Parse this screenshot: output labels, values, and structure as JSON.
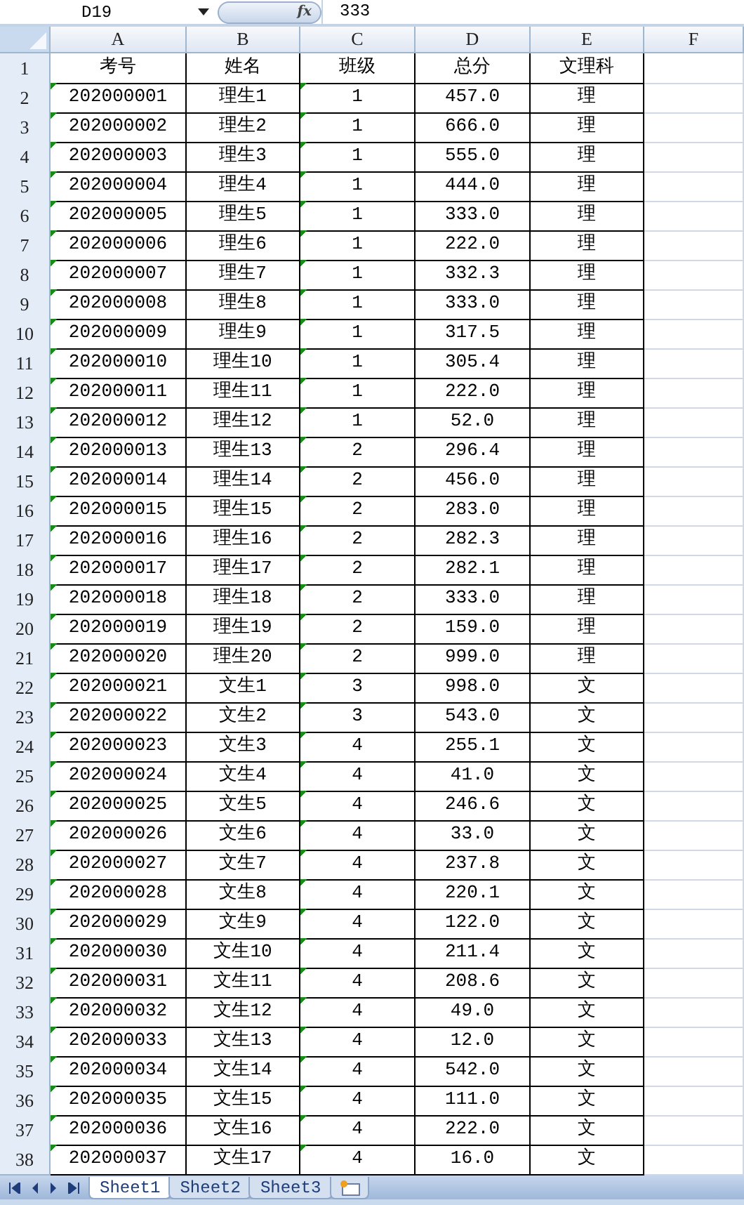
{
  "formula_bar": {
    "name_box": "D19",
    "fx": "fx",
    "value": "333"
  },
  "columns": [
    {
      "letter": "A",
      "flagged": true
    },
    {
      "letter": "B",
      "flagged": false
    },
    {
      "letter": "C",
      "flagged": true
    },
    {
      "letter": "D",
      "flagged": false
    },
    {
      "letter": "E",
      "flagged": false
    }
  ],
  "empty_column": "F",
  "rows": [
    {
      "n": "1",
      "kind": "header",
      "cells": [
        "考号",
        "姓名",
        "班级",
        "总分",
        "文理科"
      ]
    },
    {
      "n": "2",
      "kind": "data",
      "cells": [
        "202000001",
        "理生1",
        "1",
        "457.0",
        "理"
      ]
    },
    {
      "n": "3",
      "kind": "data",
      "cells": [
        "202000002",
        "理生2",
        "1",
        "666.0",
        "理"
      ]
    },
    {
      "n": "4",
      "kind": "data",
      "cells": [
        "202000003",
        "理生3",
        "1",
        "555.0",
        "理"
      ]
    },
    {
      "n": "5",
      "kind": "data",
      "cells": [
        "202000004",
        "理生4",
        "1",
        "444.0",
        "理"
      ]
    },
    {
      "n": "6",
      "kind": "data",
      "cells": [
        "202000005",
        "理生5",
        "1",
        "333.0",
        "理"
      ]
    },
    {
      "n": "7",
      "kind": "data",
      "cells": [
        "202000006",
        "理生6",
        "1",
        "222.0",
        "理"
      ]
    },
    {
      "n": "8",
      "kind": "data",
      "cells": [
        "202000007",
        "理生7",
        "1",
        "332.3",
        "理"
      ]
    },
    {
      "n": "9",
      "kind": "data",
      "cells": [
        "202000008",
        "理生8",
        "1",
        "333.0",
        "理"
      ]
    },
    {
      "n": "10",
      "kind": "data",
      "cells": [
        "202000009",
        "理生9",
        "1",
        "317.5",
        "理"
      ]
    },
    {
      "n": "11",
      "kind": "data",
      "cells": [
        "202000010",
        "理生10",
        "1",
        "305.4",
        "理"
      ]
    },
    {
      "n": "12",
      "kind": "data",
      "cells": [
        "202000011",
        "理生11",
        "1",
        "222.0",
        "理"
      ]
    },
    {
      "n": "13",
      "kind": "data",
      "cells": [
        "202000012",
        "理生12",
        "1",
        "52.0",
        "理"
      ]
    },
    {
      "n": "14",
      "kind": "data",
      "cells": [
        "202000013",
        "理生13",
        "2",
        "296.4",
        "理"
      ]
    },
    {
      "n": "15",
      "kind": "data",
      "cells": [
        "202000014",
        "理生14",
        "2",
        "456.0",
        "理"
      ]
    },
    {
      "n": "16",
      "kind": "data",
      "cells": [
        "202000015",
        "理生15",
        "2",
        "283.0",
        "理"
      ]
    },
    {
      "n": "17",
      "kind": "data",
      "cells": [
        "202000016",
        "理生16",
        "2",
        "282.3",
        "理"
      ]
    },
    {
      "n": "18",
      "kind": "data",
      "cells": [
        "202000017",
        "理生17",
        "2",
        "282.1",
        "理"
      ]
    },
    {
      "n": "19",
      "kind": "data",
      "cells": [
        "202000018",
        "理生18",
        "2",
        "333.0",
        "理"
      ]
    },
    {
      "n": "20",
      "kind": "data",
      "cells": [
        "202000019",
        "理生19",
        "2",
        "159.0",
        "理"
      ]
    },
    {
      "n": "21",
      "kind": "data",
      "cells": [
        "202000020",
        "理生20",
        "2",
        "999.0",
        "理"
      ]
    },
    {
      "n": "22",
      "kind": "data",
      "cells": [
        "202000021",
        "文生1",
        "3",
        "998.0",
        "文"
      ]
    },
    {
      "n": "23",
      "kind": "data",
      "cells": [
        "202000022",
        "文生2",
        "3",
        "543.0",
        "文"
      ]
    },
    {
      "n": "24",
      "kind": "data",
      "cells": [
        "202000023",
        "文生3",
        "4",
        "255.1",
        "文"
      ]
    },
    {
      "n": "25",
      "kind": "data",
      "cells": [
        "202000024",
        "文生4",
        "4",
        "41.0",
        "文"
      ]
    },
    {
      "n": "26",
      "kind": "data",
      "cells": [
        "202000025",
        "文生5",
        "4",
        "246.6",
        "文"
      ]
    },
    {
      "n": "27",
      "kind": "data",
      "cells": [
        "202000026",
        "文生6",
        "4",
        "33.0",
        "文"
      ]
    },
    {
      "n": "28",
      "kind": "data",
      "cells": [
        "202000027",
        "文生7",
        "4",
        "237.8",
        "文"
      ]
    },
    {
      "n": "29",
      "kind": "data",
      "cells": [
        "202000028",
        "文生8",
        "4",
        "220.1",
        "文"
      ]
    },
    {
      "n": "30",
      "kind": "data",
      "cells": [
        "202000029",
        "文生9",
        "4",
        "122.0",
        "文"
      ]
    },
    {
      "n": "31",
      "kind": "data",
      "cells": [
        "202000030",
        "文生10",
        "4",
        "211.4",
        "文"
      ]
    },
    {
      "n": "32",
      "kind": "data",
      "cells": [
        "202000031",
        "文生11",
        "4",
        "208.6",
        "文"
      ]
    },
    {
      "n": "33",
      "kind": "data",
      "cells": [
        "202000032",
        "文生12",
        "4",
        "49.0",
        "文"
      ]
    },
    {
      "n": "34",
      "kind": "data",
      "cells": [
        "202000033",
        "文生13",
        "4",
        "12.0",
        "文"
      ]
    },
    {
      "n": "35",
      "kind": "data",
      "cells": [
        "202000034",
        "文生14",
        "4",
        "542.0",
        "文"
      ]
    },
    {
      "n": "36",
      "kind": "data",
      "cells": [
        "202000035",
        "文生15",
        "4",
        "111.0",
        "文"
      ]
    },
    {
      "n": "37",
      "kind": "data",
      "cells": [
        "202000036",
        "文生16",
        "4",
        "222.0",
        "文"
      ]
    },
    {
      "n": "38",
      "kind": "data",
      "cells": [
        "202000037",
        "文生17",
        "4",
        "16.0",
        "文"
      ]
    }
  ],
  "sheet_tabs": [
    {
      "label": "Sheet1",
      "selected": true
    },
    {
      "label": "Sheet2",
      "selected": false
    },
    {
      "label": "Sheet3",
      "selected": false
    }
  ]
}
